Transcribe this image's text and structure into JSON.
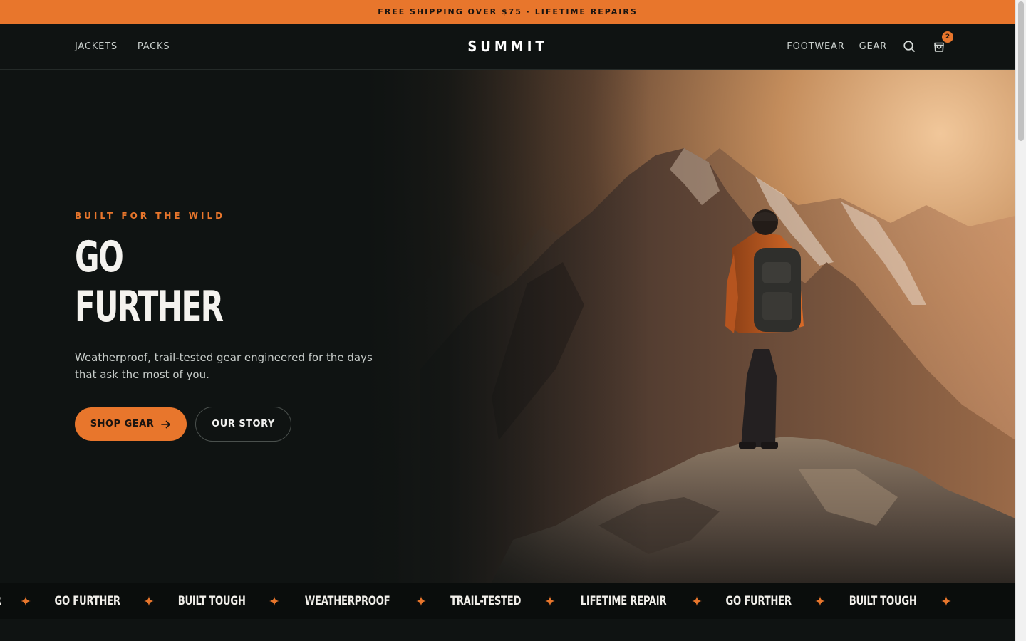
{
  "announcement": {
    "text": "FREE SHIPPING OVER $75 · LIFETIME REPAIRS"
  },
  "header": {
    "logo": "SUMMIT",
    "nav_left": [
      "JACKETS",
      "PACKS"
    ],
    "nav_right": [
      "FOOTWEAR",
      "GEAR"
    ],
    "cart_count": "2",
    "icons": [
      "search-icon",
      "shopping-bag-icon"
    ]
  },
  "hero": {
    "eyebrow": "BUILT FOR THE WILD",
    "headline_line1": "GO",
    "headline_line2": "FURTHER",
    "subcopy": "Weatherproof, trail-tested gear engineered for the days that ask the most of you.",
    "primary_cta": "SHOP GEAR",
    "secondary_cta": "OUR STORY",
    "image_subject": "hiker with backpack standing on rocky summit at sunset"
  },
  "marquee": {
    "items": [
      "IR",
      "GO FURTHER",
      "BUILT TOUGH",
      "WEATHERPROOF",
      "TRAIL-TESTED",
      "LIFETIME REPAIR",
      "GO FURTHER",
      "BUILT TOUGH"
    ]
  },
  "colors": {
    "accent": "#e8762c",
    "background": "#0f1312",
    "text": "#ffffff"
  }
}
